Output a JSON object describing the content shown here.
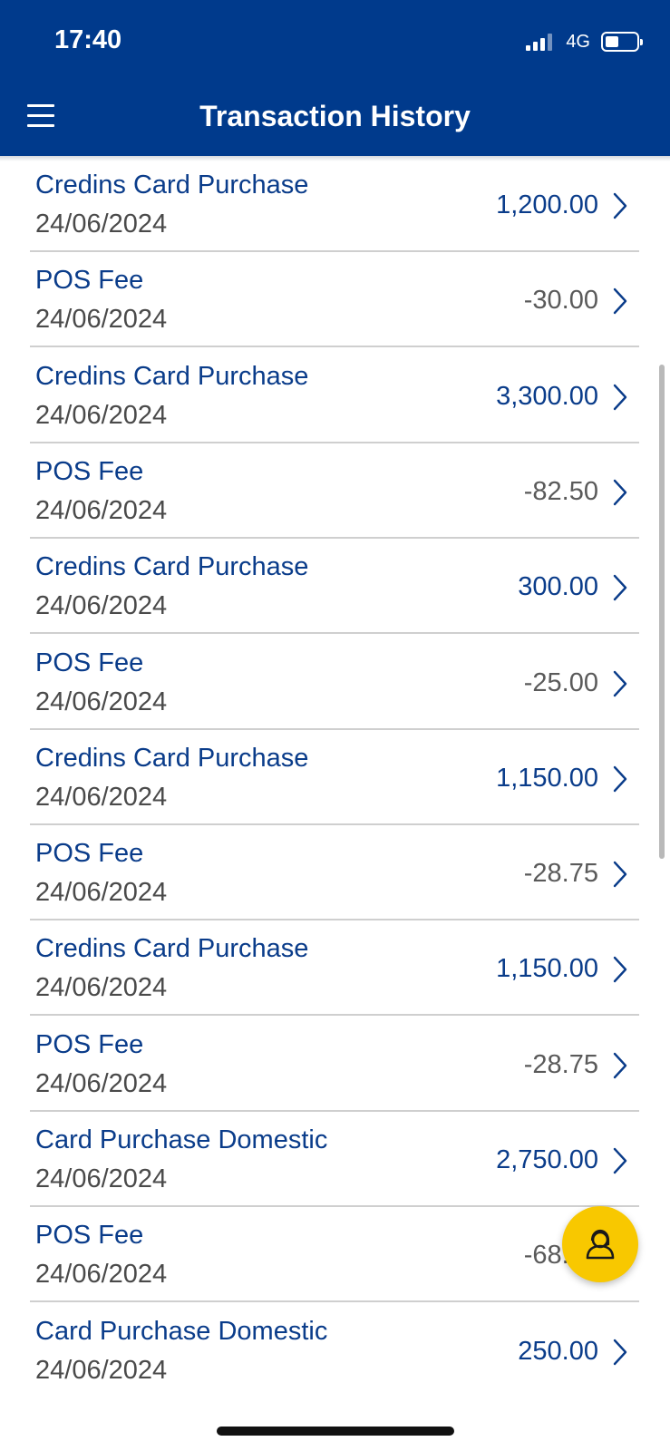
{
  "status_bar": {
    "time": "17:40",
    "network": "4G"
  },
  "header": {
    "title": "Transaction History"
  },
  "transactions": [
    {
      "title": "Credins Card Purchase",
      "date": "24/06/2024",
      "amount": "1,200.00",
      "sign": "positive"
    },
    {
      "title": "POS Fee",
      "date": "24/06/2024",
      "amount": "-30.00",
      "sign": "negative"
    },
    {
      "title": "Credins Card Purchase",
      "date": "24/06/2024",
      "amount": "3,300.00",
      "sign": "positive"
    },
    {
      "title": "POS Fee",
      "date": "24/06/2024",
      "amount": "-82.50",
      "sign": "negative"
    },
    {
      "title": "Credins Card Purchase",
      "date": "24/06/2024",
      "amount": "300.00",
      "sign": "positive"
    },
    {
      "title": "POS Fee",
      "date": "24/06/2024",
      "amount": "-25.00",
      "sign": "negative"
    },
    {
      "title": "Credins Card Purchase",
      "date": "24/06/2024",
      "amount": "1,150.00",
      "sign": "positive"
    },
    {
      "title": "POS Fee",
      "date": "24/06/2024",
      "amount": "-28.75",
      "sign": "negative"
    },
    {
      "title": "Credins Card Purchase",
      "date": "24/06/2024",
      "amount": "1,150.00",
      "sign": "positive"
    },
    {
      "title": "POS Fee",
      "date": "24/06/2024",
      "amount": "-28.75",
      "sign": "negative"
    },
    {
      "title": "Card Purchase Domestic",
      "date": "24/06/2024",
      "amount": "2,750.00",
      "sign": "positive"
    },
    {
      "title": "POS Fee",
      "date": "24/06/2024",
      "amount": "-68.75",
      "sign": "negative"
    },
    {
      "title": "Card Purchase Domestic",
      "date": "24/06/2024",
      "amount": "250.00",
      "sign": "positive"
    }
  ],
  "colors": {
    "header_bg": "#003a8c",
    "title_text": "#0a3c8a",
    "fab_bg": "#f8c800"
  },
  "icons": {
    "menu": "hamburger-icon",
    "row_action": "chevron-right-icon",
    "fab": "support-agent-icon"
  }
}
